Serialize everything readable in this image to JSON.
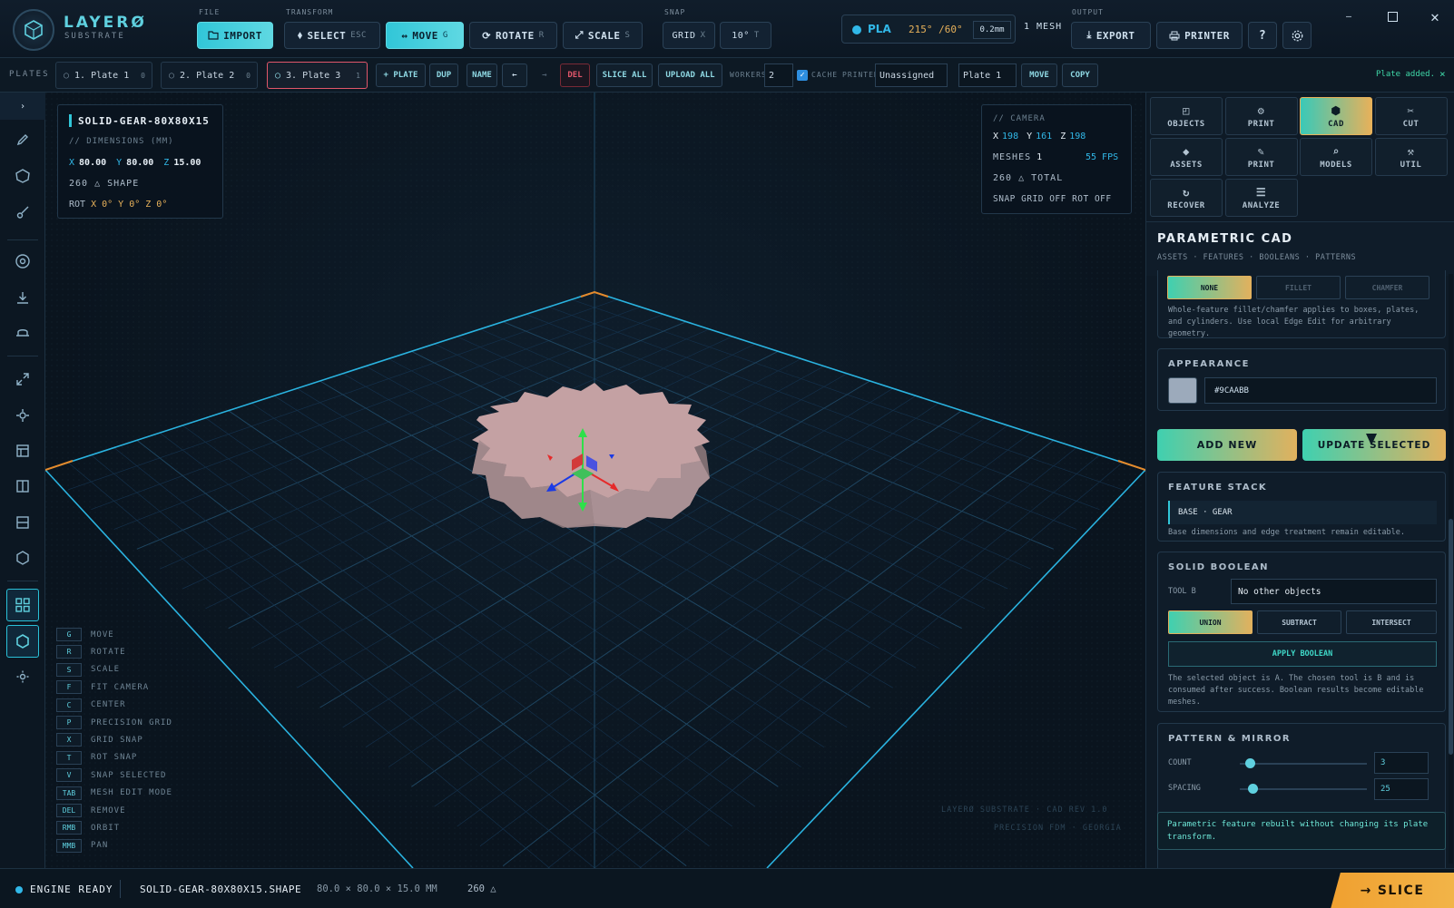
{
  "app": {
    "name": "LAYERØ",
    "subtitle": "SUBSTRATE"
  },
  "toolbar": {
    "file_label": "FILE",
    "transform_label": "TRANSFORM",
    "snap_label": "SNAP",
    "output_label": "OUTPUT",
    "import": "IMPORT",
    "select": "SELECT",
    "select_key": "ESC",
    "move": "MOVE",
    "move_key": "G",
    "rotate": "ROTATE",
    "rotate_key": "R",
    "scale": "SCALE",
    "scale_key": "S",
    "grid": "GRID",
    "grid_key": "X",
    "rot_snap": "10°",
    "rot_snap_key": "T",
    "material": "PLA",
    "temps": "215° /60°",
    "layer": "0.2mm",
    "mesh_count": "1 MESH",
    "export": "EXPORT",
    "printer": "PRINTER",
    "help": "?"
  },
  "plates": {
    "label": "PLATES",
    "tabs": [
      {
        "name": "1. Plate 1",
        "count": "0"
      },
      {
        "name": "2. Plate 2",
        "count": "0"
      },
      {
        "name": "3. Plate 3",
        "count": "1"
      }
    ],
    "add_plate": "+ PLATE",
    "dup": "DUP",
    "name": "NAME",
    "prev": "←",
    "next": "→",
    "del": "DEL",
    "slice_all": "SLICE ALL",
    "upload_all": "UPLOAD ALL",
    "workers_label": "WORKERS",
    "workers_value": "2",
    "cache_label": "CACHE",
    "printer_label": "PRINTER",
    "printer_value": "Unassigned",
    "target_plate": "Plate 1",
    "move": "MOVE",
    "copy": "COPY",
    "status": "Plate added.",
    "status_close": "×"
  },
  "object_info": {
    "name": "SOLID-GEAR-80X80X15",
    "dims_label": "// DIMENSIONS (MM)",
    "x": "80.00",
    "y": "80.00",
    "z": "15.00",
    "tris": "260 △ SHAPE",
    "rot_label": "ROT",
    "rot": "X 0° Y 0° Z 0°"
  },
  "camera": {
    "label": "// CAMERA",
    "x": "198",
    "y": "161",
    "z": "198",
    "meshes_label": "MESHES",
    "meshes": "1",
    "fps": "55 FPS",
    "total": "260 △ TOTAL",
    "snap": "SNAP GRID OFF ROT OFF"
  },
  "shortcuts": [
    {
      "key": "G",
      "label": "MOVE"
    },
    {
      "key": "R",
      "label": "ROTATE"
    },
    {
      "key": "S",
      "label": "SCALE"
    },
    {
      "key": "F",
      "label": "FIT CAMERA"
    },
    {
      "key": "C",
      "label": "CENTER"
    },
    {
      "key": "P",
      "label": "PRECISION GRID"
    },
    {
      "key": "X",
      "label": "GRID SNAP"
    },
    {
      "key": "T",
      "label": "ROT SNAP"
    },
    {
      "key": "V",
      "label": "SNAP SELECTED"
    },
    {
      "key": "TAB",
      "label": "MESH EDIT MODE"
    },
    {
      "key": "DEL",
      "label": "REMOVE"
    },
    {
      "key": "RMB",
      "label": "ORBIT"
    },
    {
      "key": "MMB",
      "label": "PAN"
    }
  ],
  "watermark": {
    "line1": "LAYERØ SUBSTRATE · CAD REV 1.0",
    "line2": "PRECISION FDM · GEORGIA"
  },
  "right_tabs": [
    {
      "label": "OBJECTS",
      "icon": "cube-icon"
    },
    {
      "label": "PRINT",
      "icon": "gear-icon"
    },
    {
      "label": "CAD",
      "icon": "hexagon-icon"
    },
    {
      "label": "CUT",
      "icon": "scissors-icon"
    },
    {
      "label": "ASSETS",
      "icon": "diamond-icon"
    },
    {
      "label": "PRINT",
      "icon": "pen-icon"
    },
    {
      "label": "MODELS",
      "icon": "search-icon"
    },
    {
      "label": "UTIL",
      "icon": "tool-icon"
    },
    {
      "label": "RECOVER",
      "icon": "refresh-icon"
    },
    {
      "label": "ANALYZE",
      "icon": "list-icon"
    }
  ],
  "cad": {
    "title": "PARAMETRIC CAD",
    "subtitle": "ASSETS · FEATURES · BOOLEANS · PATTERNS",
    "edge_options": [
      "NONE",
      "FILLET",
      "CHAMFER"
    ],
    "edge_note": "Whole-feature fillet/chamfer applies to boxes, plates, and cylinders. Use local Edge Edit for arbitrary geometry.",
    "appearance_label": "APPEARANCE",
    "color": "#9CAABB",
    "add_new": "ADD NEW",
    "update_selected": "UPDATE SELECTED",
    "feature_stack_label": "FEATURE STACK",
    "feature_item": "BASE · GEAR",
    "feature_note": "Base dimensions and edge treatment remain editable.",
    "boolean_label": "SOLID BOOLEAN",
    "tool_b_label": "TOOL B",
    "tool_b_value": "No other objects",
    "boolean_ops": [
      "UNION",
      "SUBTRACT",
      "INTERSECT"
    ],
    "apply_boolean": "APPLY BOOLEAN",
    "boolean_note": "The selected object is A. The chosen tool is B and is consumed after success. Boolean results become editable meshes.",
    "pattern_label": "PATTERN & MIRROR",
    "count_label": "COUNT",
    "count_value": "3",
    "spacing_label": "SPACING",
    "spacing_value": "25",
    "toast": "Parametric feature rebuilt without changing its plate transform."
  },
  "status": {
    "engine": "ENGINE READY",
    "file": "SOLID-GEAR-80X80X15.SHAPE",
    "dims": "80.0 × 80.0 × 15.0 MM",
    "tris": "260 △",
    "slice": "SLICE"
  },
  "colors": {
    "accent": "#31c6d8",
    "warm": "#e7b15a",
    "danger": "#e0566a",
    "gear": "#c9a3a3"
  }
}
